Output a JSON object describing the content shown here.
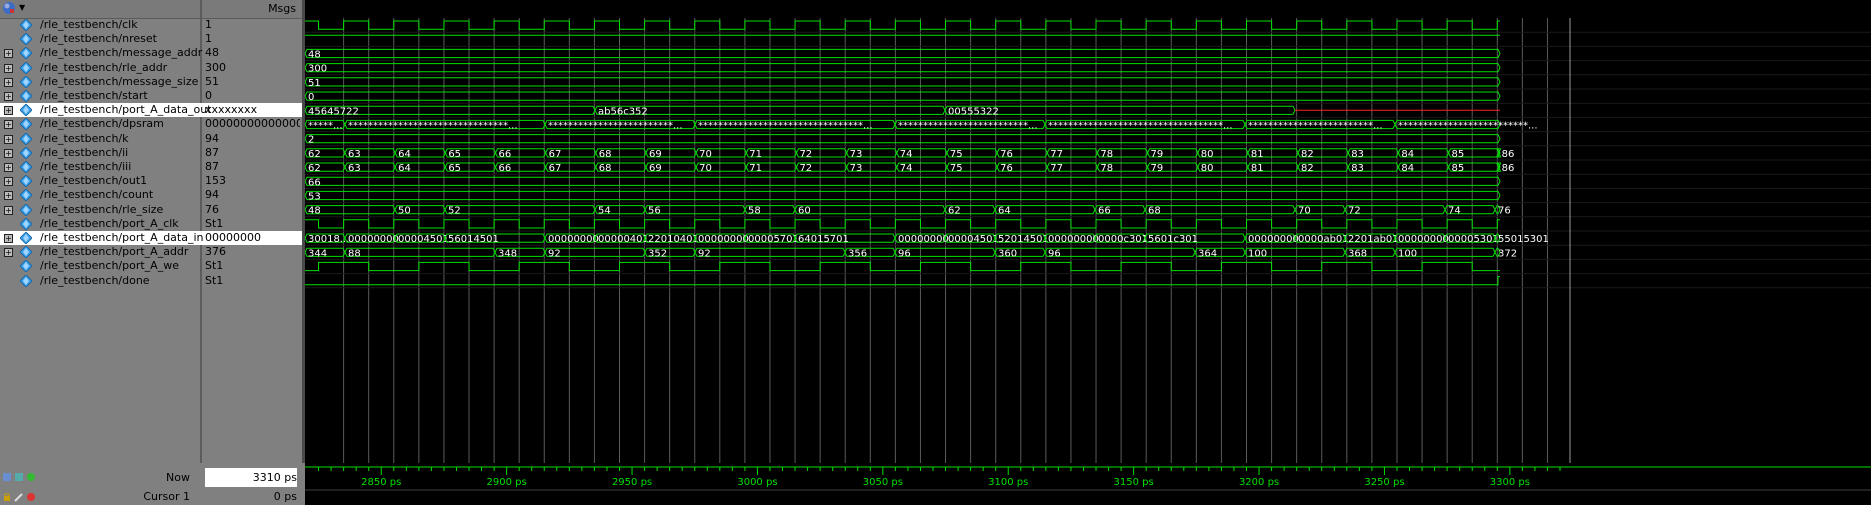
{
  "header": {
    "msgs_label": "Msgs"
  },
  "signals": [
    {
      "name": "/rle_testbench/clk",
      "value": "1",
      "expandable": false,
      "selected": false
    },
    {
      "name": "/rle_testbench/nreset",
      "value": "1",
      "expandable": false,
      "selected": false
    },
    {
      "name": "/rle_testbench/message_addr",
      "value": "48",
      "expandable": true,
      "selected": false
    },
    {
      "name": "/rle_testbench/rle_addr",
      "value": "300",
      "expandable": true,
      "selected": false
    },
    {
      "name": "/rle_testbench/message_size",
      "value": "51",
      "expandable": true,
      "selected": false
    },
    {
      "name": "/rle_testbench/start",
      "value": "0",
      "expandable": true,
      "selected": false
    },
    {
      "name": "/rle_testbench/port_A_data_out",
      "value": "xxxxxxxx",
      "expandable": true,
      "selected": true
    },
    {
      "name": "/rle_testbench/dpsram",
      "value": "0000000000000000",
      "expandable": true,
      "selected": false
    },
    {
      "name": "/rle_testbench/k",
      "value": "94",
      "expandable": true,
      "selected": false
    },
    {
      "name": "/rle_testbench/ii",
      "value": "87",
      "expandable": true,
      "selected": false
    },
    {
      "name": "/rle_testbench/iii",
      "value": "87",
      "expandable": true,
      "selected": false
    },
    {
      "name": "/rle_testbench/out1",
      "value": "153",
      "expandable": true,
      "selected": false
    },
    {
      "name": "/rle_testbench/count",
      "value": "94",
      "expandable": true,
      "selected": false
    },
    {
      "name": "/rle_testbench/rle_size",
      "value": "76",
      "expandable": true,
      "selected": false
    },
    {
      "name": "/rle_testbench/port_A_clk",
      "value": "St1",
      "expandable": false,
      "selected": false
    },
    {
      "name": "/rle_testbench/port_A_data_in",
      "value": "00000000",
      "expandable": true,
      "selected": true
    },
    {
      "name": "/rle_testbench/port_A_addr",
      "value": "376",
      "expandable": true,
      "selected": false
    },
    {
      "name": "/rle_testbench/port_A_we",
      "value": "St1",
      "expandable": false,
      "selected": false
    },
    {
      "name": "/rle_testbench/done",
      "value": "St1",
      "expandable": false,
      "selected": false
    }
  ],
  "status": {
    "now_label": "Now",
    "now_value": "3310 ps",
    "cursor_label": "Cursor 1",
    "cursor_value": "0 ps"
  },
  "timeline": {
    "labels": [
      "2850 ps",
      "2900 ps",
      "2950 ps",
      "3000 ps",
      "3050 ps",
      "3100 ps",
      "3150 ps",
      "3200 ps",
      "3250 ps",
      "3300 ps"
    ]
  },
  "waves": {
    "message_addr": "48",
    "rle_addr": "300",
    "message_size": "51",
    "start": "0",
    "port_A_data_out": [
      "45645722",
      "ab56c352",
      "00555322"
    ],
    "dpsram": [
      "*****...",
      "********************************...",
      "*************************...",
      "*********************************...",
      "**************************...",
      "***********************************...",
      "*************************...",
      "**************************..."
    ],
    "k": "2",
    "ii": [
      "62",
      "63",
      "64",
      "65",
      "66",
      "67",
      "68",
      "69",
      "70",
      "71",
      "72",
      "73",
      "74",
      "75",
      "76",
      "77",
      "78",
      "79",
      "80",
      "81",
      "82",
      "83",
      "84",
      "85",
      "86"
    ],
    "iii": [
      "62",
      "63",
      "64",
      "65",
      "66",
      "67",
      "68",
      "69",
      "70",
      "71",
      "72",
      "73",
      "74",
      "75",
      "76",
      "77",
      "78",
      "79",
      "80",
      "81",
      "82",
      "83",
      "84",
      "85",
      "86"
    ],
    "out1": "66",
    "count": "53",
    "rle_size": [
      "48",
      "50",
      "52",
      "54",
      "56",
      "58",
      "60",
      "62",
      "64",
      "66",
      "68",
      "70",
      "72",
      "74",
      "76"
    ],
    "port_A_data_in": [
      "30018...",
      "00000000",
      "00004501",
      "56014501",
      "00000000",
      "00000401",
      "22010401",
      "00000000",
      "00005701",
      "64015701",
      "00000000",
      "00004501",
      "52014501",
      "00000000",
      "0000c301",
      "5601c301",
      "00000000",
      "0000ab01",
      "2201ab01",
      "00000000",
      "00005301",
      "55015301"
    ],
    "port_A_addr": [
      "344",
      "88",
      "348",
      "92",
      "352",
      "92",
      "356",
      "96",
      "360",
      "96",
      "364",
      "100",
      "368",
      "100",
      "372"
    ]
  },
  "colors": {
    "wave": "#00e000",
    "cursor": "#ff2020",
    "grid": "#5a5a5a",
    "background": "#000000",
    "panel": "#808080"
  }
}
